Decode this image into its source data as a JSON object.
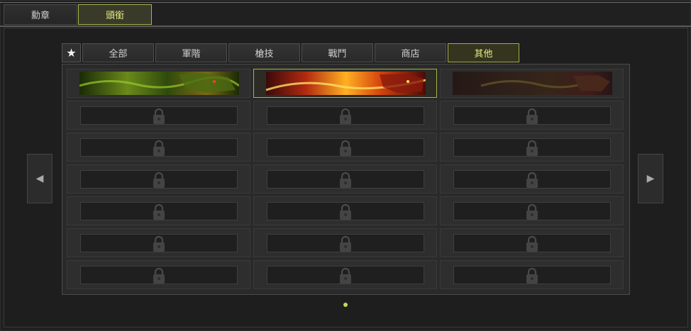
{
  "main_tabs": [
    {
      "label": "勳章",
      "active": false
    },
    {
      "label": "頭銜",
      "active": true
    }
  ],
  "sub_tabs": {
    "star_icon": "★",
    "items": [
      {
        "label": "全部",
        "active": false
      },
      {
        "label": "軍階",
        "active": false
      },
      {
        "label": "槍技",
        "active": false
      },
      {
        "label": "戰鬥",
        "active": false
      },
      {
        "label": "商店",
        "active": false
      },
      {
        "label": "其他",
        "active": true
      }
    ]
  },
  "grid": {
    "columns": 3,
    "rows": 7,
    "unlocked_titles": [
      {
        "name": "green-dragon-banner",
        "selected": false
      },
      {
        "name": "fire-dragon-banner",
        "selected": true
      },
      {
        "name": "golden-dragon-banner",
        "selected": false
      }
    ],
    "locked_icon": "lock-icon"
  },
  "navigation": {
    "prev_icon": "◀",
    "next_icon": "▶",
    "current_page": 1
  },
  "colors": {
    "accent": "#a8b44a",
    "accent_text": "#e8f08a",
    "page_indicator": "#c8d65a"
  }
}
